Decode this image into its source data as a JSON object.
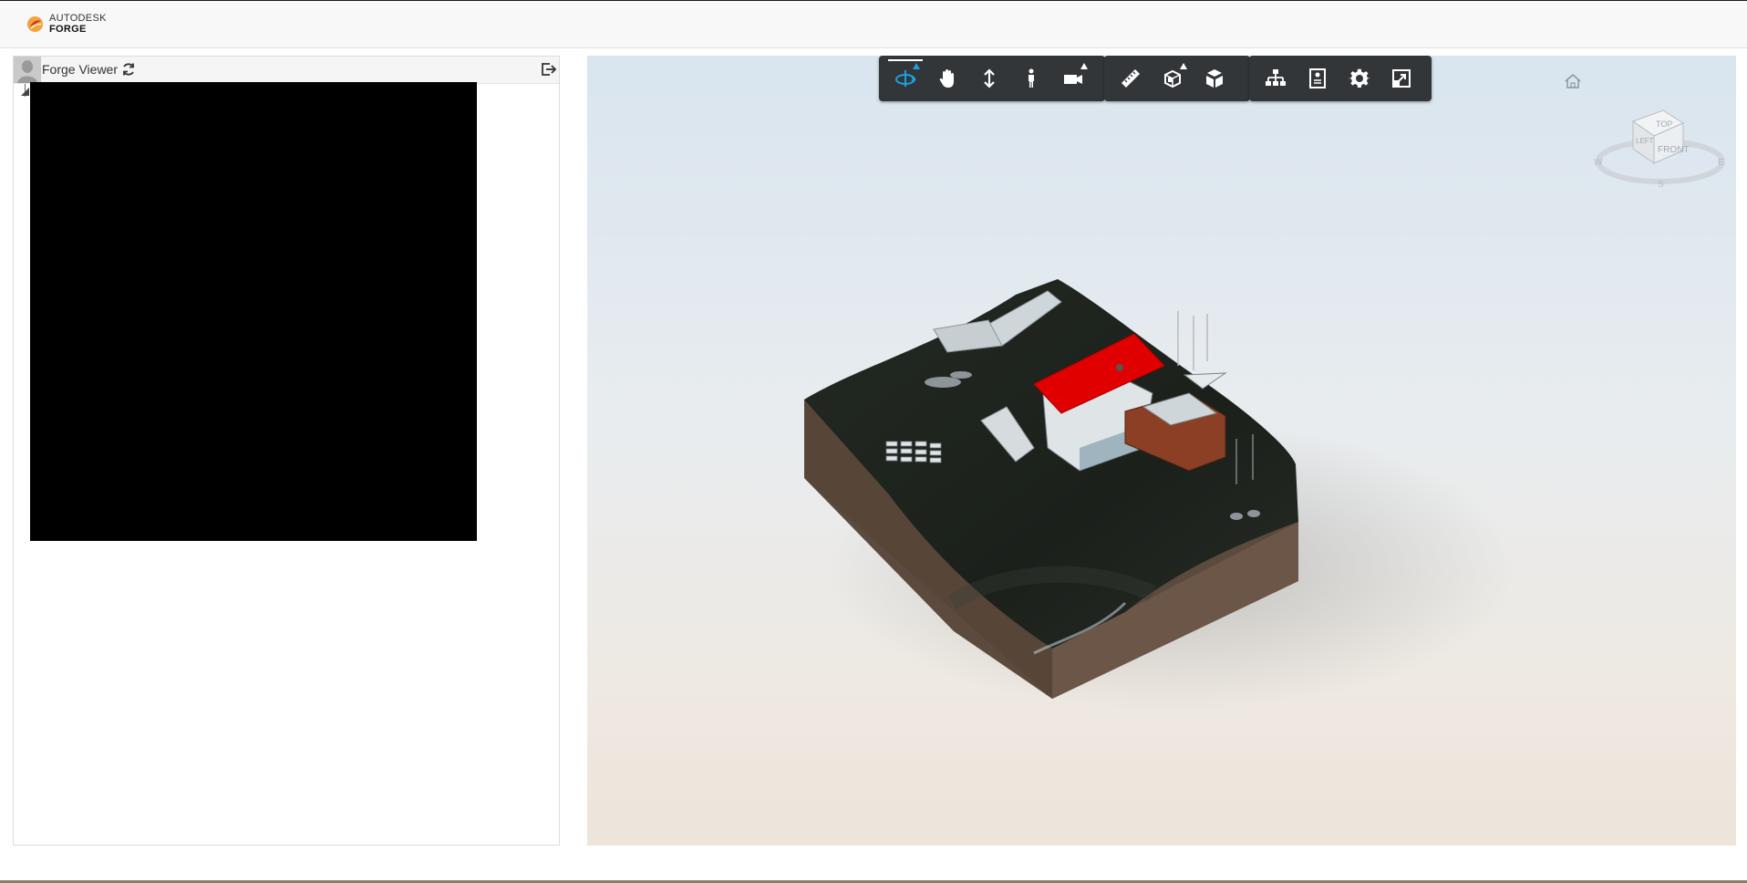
{
  "header": {
    "brand_line1": "AUTODESK",
    "brand_line2": "FORGE"
  },
  "left_panel": {
    "title": "Forge Viewer"
  },
  "icons": {
    "brand": "autodesk-forge-logo",
    "refresh": "refresh-icon",
    "signout": "sign-out-icon",
    "home": "home-icon",
    "viewcube": "viewcube",
    "orbit": "orbit-icon",
    "pan": "pan-hand-icon",
    "zoom": "zoom-vertical-arrows-icon",
    "walk": "first-person-walk-icon",
    "camera": "camera-icon",
    "measure": "ruler-icon",
    "section": "section-box-icon",
    "explode": "explode-model-icon",
    "model_browser": "model-browser-tree-icon",
    "properties": "properties-icon",
    "settings": "gear-icon",
    "fullscreen": "fullscreen-icon"
  },
  "viewcube": {
    "top": "TOP",
    "front": "FRONT",
    "left": "LEFT",
    "compass_w": "W",
    "compass_e": "E",
    "compass_s": "S"
  },
  "colors": {
    "toolbar_bg": "#333639",
    "active_tool": "#1e9fe0",
    "roof": "#e00000",
    "terrain_top": "#1f241f",
    "terrain_side": "#5c4a3e"
  }
}
